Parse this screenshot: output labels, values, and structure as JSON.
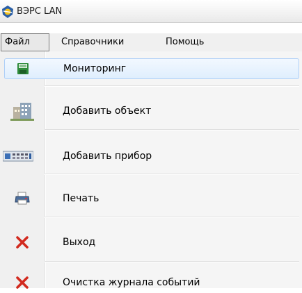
{
  "window": {
    "title": "ВЭРС LAN"
  },
  "menubar": {
    "items": [
      {
        "label": "Файл"
      },
      {
        "label": "Справочники"
      },
      {
        "label": "Помощь"
      }
    ]
  },
  "file_menu": {
    "items": [
      {
        "label": "Мониторинг",
        "icon": "floppy-disk-icon",
        "highlighted": true
      },
      {
        "label": "Добавить объект",
        "icon": "building-icon"
      },
      {
        "label": "Добавить прибор",
        "icon": "device-icon"
      },
      {
        "label": "Печать",
        "icon": "printer-icon"
      },
      {
        "label": "Выход",
        "icon": "red-x-icon"
      },
      {
        "label": "Очистка журнала событий",
        "icon": "red-x-icon"
      }
    ]
  },
  "colors": {
    "highlight_border": "#aecff7",
    "floppy_green": "#2e8b3a",
    "exit_red": "#d22a1f"
  }
}
